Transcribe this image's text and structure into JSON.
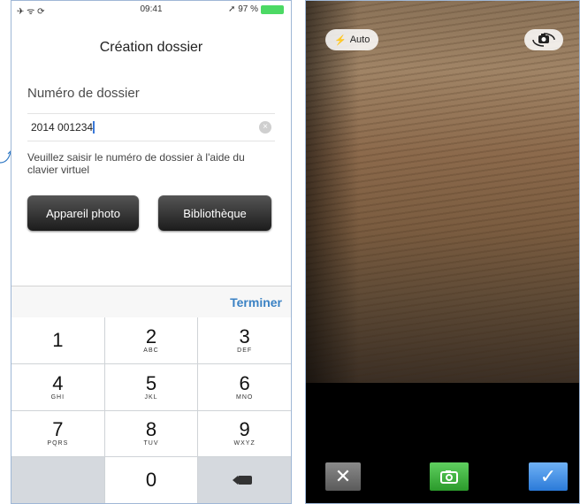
{
  "left_phone": {
    "status": {
      "signal": "✈ ᯤ ⟳",
      "time": "09:41",
      "battery": "➚ 97 %"
    },
    "title": "Création dossier",
    "section_label": "Numéro de dossier",
    "input_value": "2014 001234",
    "hint": "Veuillez saisir le numéro de dossier à l'aide du clavier virtuel",
    "buttons": {
      "camera": "Appareil photo",
      "library": "Bibliothèque"
    },
    "keyboard": {
      "done_label": "Terminer",
      "keys": [
        {
          "n": "1",
          "l": ""
        },
        {
          "n": "2",
          "l": "ABC"
        },
        {
          "n": "3",
          "l": "DEF"
        },
        {
          "n": "4",
          "l": "GHI"
        },
        {
          "n": "5",
          "l": "JKL"
        },
        {
          "n": "6",
          "l": "MNO"
        },
        {
          "n": "7",
          "l": "PQRS"
        },
        {
          "n": "8",
          "l": "TUV"
        },
        {
          "n": "9",
          "l": "WXYZ"
        },
        {
          "n": "0",
          "l": ""
        }
      ]
    }
  },
  "right_phone": {
    "flash_label": "Auto",
    "colors": {
      "cancel": "#7a7a7a",
      "shutter": "#3cb33c",
      "confirm": "#3b8be0"
    }
  }
}
